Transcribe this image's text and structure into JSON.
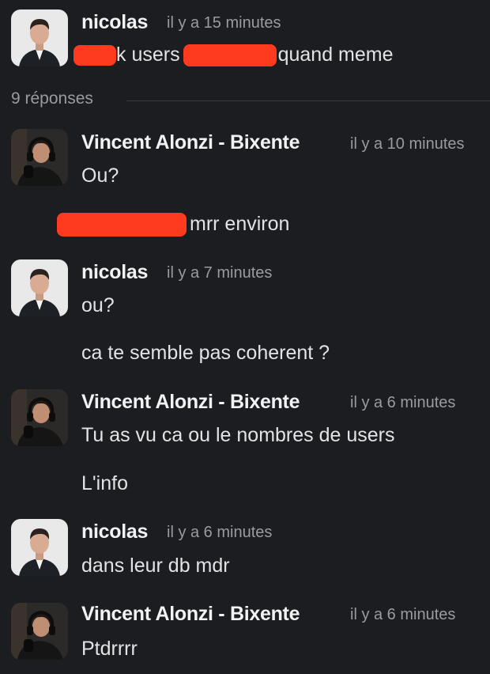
{
  "thread": {
    "replies_label": "9 réponses",
    "messages": [
      {
        "author": "nicolas",
        "time": "il y a 15 minutes",
        "lines": [
          {
            "parts": [
              "k users",
              "quand meme"
            ]
          }
        ]
      },
      {
        "author": "Vincent Alonzi - Bixente",
        "time": "il y a 10 minutes",
        "lines": [
          {
            "text": "Ou?"
          },
          {
            "parts": [
              "mrr environ"
            ]
          }
        ]
      },
      {
        "author": "nicolas",
        "time": "il y a 7 minutes",
        "lines": [
          {
            "text": "ou?"
          },
          {
            "text": "ca te semble pas coherent ?"
          }
        ]
      },
      {
        "author": "Vincent Alonzi - Bixente",
        "time": "il y a 6 minutes",
        "lines": [
          {
            "text": "Tu as vu ca ou le nombres de users"
          },
          {
            "text": "L'info"
          }
        ]
      },
      {
        "author": "nicolas",
        "time": "il y a 6 minutes",
        "lines": [
          {
            "text": "dans leur db mdr"
          }
        ]
      },
      {
        "author": "Vincent Alonzi - Bixente",
        "time": "il y a 6 minutes",
        "lines": [
          {
            "text": "Ptdrrrr"
          }
        ]
      }
    ]
  },
  "colors": {
    "background": "#1b1d21",
    "redaction": "#ff3b1f",
    "muted": "#9a9b9e"
  },
  "icons": {
    "avatar_nicolas": "avatar-nicolas",
    "avatar_vincent": "avatar-vincent"
  }
}
